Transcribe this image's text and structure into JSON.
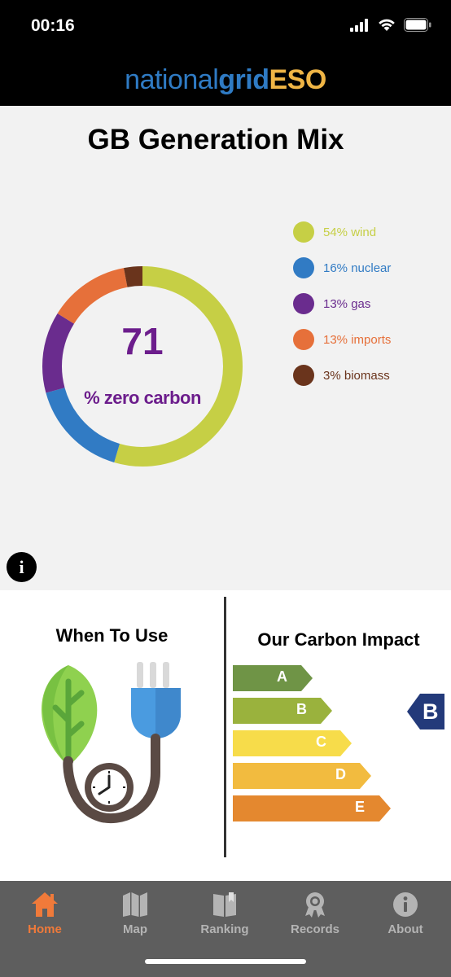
{
  "status_bar": {
    "time": "00:16"
  },
  "brand": {
    "part1": "national",
    "part2": "grid",
    "part3": "ESO"
  },
  "generation_mix": {
    "title": "GB Generation Mix",
    "zero_carbon_value": "71",
    "zero_carbon_caption": "% zero carbon",
    "legend": [
      {
        "label": "54% wind",
        "percent": 54,
        "color": "#c6cf45"
      },
      {
        "label": "16% nuclear",
        "percent": 16,
        "color": "#317bc4"
      },
      {
        "label": "13% gas",
        "percent": 13,
        "color": "#6a2c8e"
      },
      {
        "label": "13% imports",
        "percent": 13,
        "color": "#e6703a"
      },
      {
        "label": "3% biomass",
        "percent": 3,
        "color": "#6a341c"
      }
    ],
    "info_label": "i"
  },
  "when_to_use": {
    "title": "When To Use"
  },
  "carbon_impact": {
    "title": "Our Carbon Impact",
    "ratings": [
      {
        "label": "A",
        "color": "#6f9446"
      },
      {
        "label": "B",
        "color": "#9ab23d"
      },
      {
        "label": "C",
        "color": "#f7dc4a"
      },
      {
        "label": "D",
        "color": "#f2bb3f"
      },
      {
        "label": "E",
        "color": "#e4882f"
      }
    ],
    "current_rating": "B",
    "current_rating_color": "#233a7a"
  },
  "tab_bar": {
    "active_color": "#f07a3a",
    "inactive_color": "#b4b4b4",
    "tabs": [
      {
        "label": "Home",
        "icon": "home-icon",
        "active": true
      },
      {
        "label": "Map",
        "icon": "map-icon",
        "active": false
      },
      {
        "label": "Ranking",
        "icon": "ranking-book-icon",
        "active": false
      },
      {
        "label": "Records",
        "icon": "award-ribbon-icon",
        "active": false
      },
      {
        "label": "About",
        "icon": "info-circle-icon",
        "active": false
      }
    ]
  }
}
